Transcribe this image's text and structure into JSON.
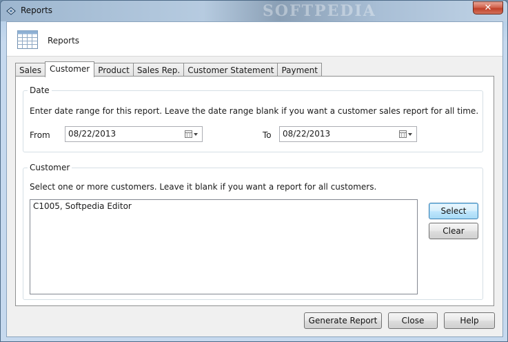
{
  "window": {
    "title": "Reports",
    "close_symbol": "✕"
  },
  "header": {
    "title": "Reports",
    "icon": "report-grid-icon"
  },
  "tabs": [
    {
      "label": "Sales"
    },
    {
      "label": "Customer"
    },
    {
      "label": "Product"
    },
    {
      "label": "Sales Rep."
    },
    {
      "label": "Customer Statement"
    },
    {
      "label": "Payment"
    }
  ],
  "active_tab": "Customer",
  "date_group": {
    "legend": "Date",
    "description": "Enter date range for this report. Leave the date range blank if you want a customer sales report for all time.",
    "from_label": "From",
    "from_value": "08/22/2013",
    "to_label": "To",
    "to_value": "08/22/2013"
  },
  "customer_group": {
    "legend": "Customer",
    "description": "Select one or more customers. Leave it blank if you want a report for all customers.",
    "items": [
      "C1005, Softpedia Editor"
    ],
    "select_label": "Select",
    "clear_label": "Clear"
  },
  "footer": {
    "generate_label": "Generate Report",
    "close_label": "Close",
    "help_label": "Help"
  },
  "colors": {
    "accent": "#3c7fb1",
    "close_red": "#c0412a"
  }
}
